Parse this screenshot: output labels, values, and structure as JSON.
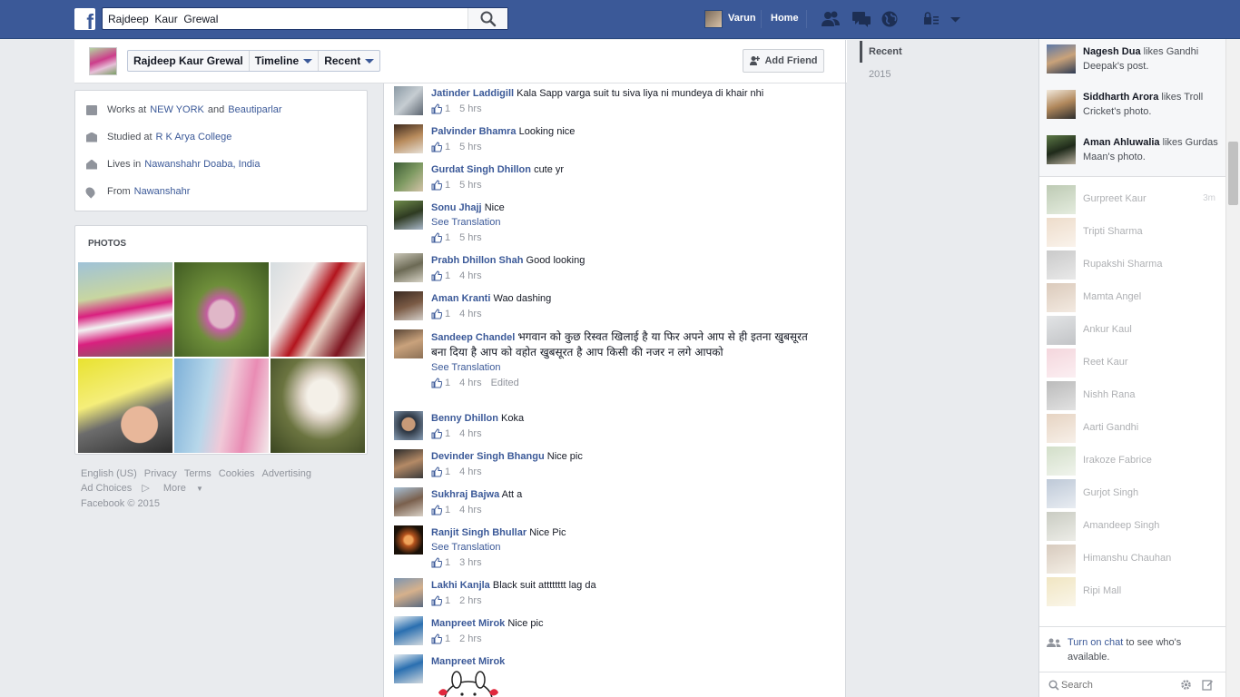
{
  "topbar": {
    "logo_letter": "f",
    "search_value": "Rajdeep  Kaur  Grewal",
    "user_name": "Varun",
    "home_label": "Home"
  },
  "profile_bar": {
    "name": "Rajdeep  Kaur  Grewal",
    "timeline_label": "Timeline",
    "recent_label": "Recent",
    "add_friend_label": "Add Friend"
  },
  "intro": [
    {
      "prefix": "Works  at",
      "link1": "NEW  YORK",
      "mid": "and",
      "link2": "Beautiparlar"
    },
    {
      "prefix": "Studied  at",
      "link1": "R  K  Arya  College",
      "mid": "",
      "link2": ""
    },
    {
      "prefix": "Lives  in",
      "link1": "Nawanshahr  Doaba,  India",
      "mid": "",
      "link2": ""
    },
    {
      "prefix": "From",
      "link1": "Nawanshahr",
      "mid": "",
      "link2": ""
    }
  ],
  "photos": {
    "title": "PHOTOS"
  },
  "footer": {
    "english": "English  (US)",
    "privacy": "Privacy",
    "terms": "Terms",
    "cookies": "Cookies",
    "advertising": "Advertising",
    "ad_choices": "Ad  Choices",
    "more": "More",
    "copyright": "Facebook  ©  2015"
  },
  "comments": [
    {
      "author": "Jatinder  Laddigill",
      "text": "Kala  Sapp  varga  suit  tu  siva  liya  ni  mundeya  di  khair  nhi",
      "translate": "",
      "likes": "1",
      "time": "5  hrs",
      "edited": ""
    },
    {
      "author": "Palvinder  Bhamra",
      "text": "Looking  nice",
      "translate": "",
      "likes": "1",
      "time": "5  hrs",
      "edited": ""
    },
    {
      "author": "Gurdat  Singh  Dhillon",
      "text": "cute  yr",
      "translate": "",
      "likes": "1",
      "time": "5  hrs",
      "edited": ""
    },
    {
      "author": "Sonu  Jhajj",
      "text": "Nice",
      "translate": "See  Translation",
      "likes": "1",
      "time": "5  hrs",
      "edited": ""
    },
    {
      "author": "Prabh  Dhillon  Shah",
      "text": "Good  looking",
      "translate": "",
      "likes": "1",
      "time": "4  hrs",
      "edited": ""
    },
    {
      "author": "Aman  Kranti",
      "text": "Wao  dashing",
      "translate": "",
      "likes": "1",
      "time": "4  hrs",
      "edited": ""
    },
    {
      "author": "Sandeep  Chandel",
      "text": "भगवान को कुछ रिस्वत खिलाई है या फिर अपने आप से ही इतना खुबसूरत बना दिया है आप को वहोत खुबसूरत है आप किसी की नजर न लगे आपको",
      "translate": "See  Translation",
      "likes": "1",
      "time": "4  hrs",
      "edited": "Edited"
    },
    {
      "author": "Benny  Dhillon",
      "text": "Koka",
      "translate": "",
      "likes": "1",
      "time": "4  hrs",
      "edited": ""
    },
    {
      "author": "Devinder  Singh  Bhangu",
      "text": "Nice  pic",
      "translate": "",
      "likes": "1",
      "time": "4  hrs",
      "edited": ""
    },
    {
      "author": "Sukhraj  Bajwa",
      "text": "Att  a",
      "translate": "",
      "likes": "1",
      "time": "4  hrs",
      "edited": ""
    },
    {
      "author": "Ranjit  Singh  Bhullar",
      "text": "Nice  Pic",
      "translate": "See  Translation",
      "likes": "1",
      "time": "3  hrs",
      "edited": ""
    },
    {
      "author": "Lakhi  Kanjla",
      "text": "Black  suit  atttttttt  lag  da",
      "translate": "",
      "likes": "1",
      "time": "2  hrs",
      "edited": ""
    },
    {
      "author": "Manpreet  Mirok",
      "text": "Nice  pic",
      "translate": "",
      "likes": "1",
      "time": "2  hrs",
      "edited": ""
    },
    {
      "author": "Manpreet  Mirok",
      "text": "",
      "translate": "",
      "likes": "",
      "time": "",
      "edited": ""
    }
  ],
  "recent_nav": {
    "recent": "Recent",
    "year": "2015"
  },
  "ticker": [
    {
      "name": "Nagesh  Dua",
      "text": "likes  Gandhi  Deepak's  post."
    },
    {
      "name": "Siddharth  Arora",
      "text": "likes  Troll  Cricket's  photo."
    },
    {
      "name": "Aman  Ahluwalia",
      "text": "likes  Gurdas  Maan's  photo."
    }
  ],
  "buddies": [
    {
      "name": "Gurpreet  Kaur",
      "time": "3m"
    },
    {
      "name": "Tripti  Sharma",
      "time": ""
    },
    {
      "name": "Rupakshi  Sharma",
      "time": ""
    },
    {
      "name": "Mamta  Angel",
      "time": ""
    },
    {
      "name": "Ankur  Kaul",
      "time": ""
    },
    {
      "name": "Reet  Kaur",
      "time": ""
    },
    {
      "name": "Nishh  Rana",
      "time": ""
    },
    {
      "name": "Aarti  Gandhi",
      "time": ""
    },
    {
      "name": "Irakoze  Fabrice",
      "time": ""
    },
    {
      "name": "Gurjot  Singh",
      "time": ""
    },
    {
      "name": "Amandeep  Singh",
      "time": ""
    },
    {
      "name": "Himanshu  Chauhan",
      "time": ""
    },
    {
      "name": "Ripi  Mall",
      "time": ""
    }
  ],
  "chat": {
    "turn_on": "Turn  on  chat",
    "rest": "to  see  who's  available.",
    "search_placeholder": "Search"
  },
  "colors": {
    "brand": "#3b5998",
    "link": "#3b5998",
    "bg": "#e9ebee"
  }
}
